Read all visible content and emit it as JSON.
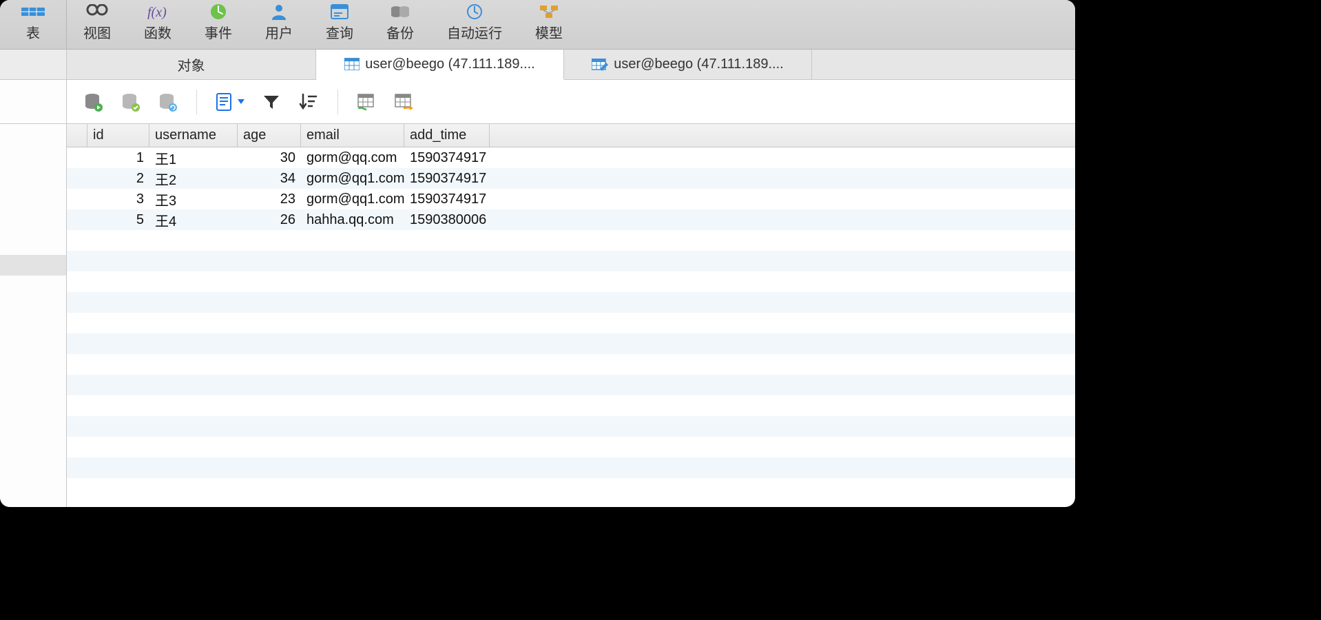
{
  "topbar": {
    "truncated_first": "表",
    "items": [
      {
        "label": "视图"
      },
      {
        "label": "函数"
      },
      {
        "label": "事件"
      },
      {
        "label": "用户"
      },
      {
        "label": "查询"
      },
      {
        "label": "备份"
      },
      {
        "label": "自动运行"
      },
      {
        "label": "模型"
      }
    ]
  },
  "tabs": {
    "items": [
      {
        "label": "对象",
        "icon": "none",
        "active": false
      },
      {
        "label": "user@beego (47.111.189....",
        "icon": "table",
        "active": true
      },
      {
        "label": "user@beego (47.111.189....",
        "icon": "table-edit",
        "active": false
      }
    ]
  },
  "grid": {
    "columns": [
      "id",
      "username",
      "age",
      "email",
      "add_time"
    ],
    "rows": [
      {
        "id": "1",
        "username": "王1",
        "age": "30",
        "email": "gorm@qq.com",
        "add_time": "1590374917"
      },
      {
        "id": "2",
        "username": "王2",
        "age": "34",
        "email": "gorm@qq1.com",
        "add_time": "1590374917"
      },
      {
        "id": "3",
        "username": "王3",
        "age": "23",
        "email": "gorm@qq1.com",
        "add_time": "1590374917"
      },
      {
        "id": "5",
        "username": "王4",
        "age": "26",
        "email": "hahha.qq.com",
        "add_time": "1590380006"
      }
    ]
  }
}
